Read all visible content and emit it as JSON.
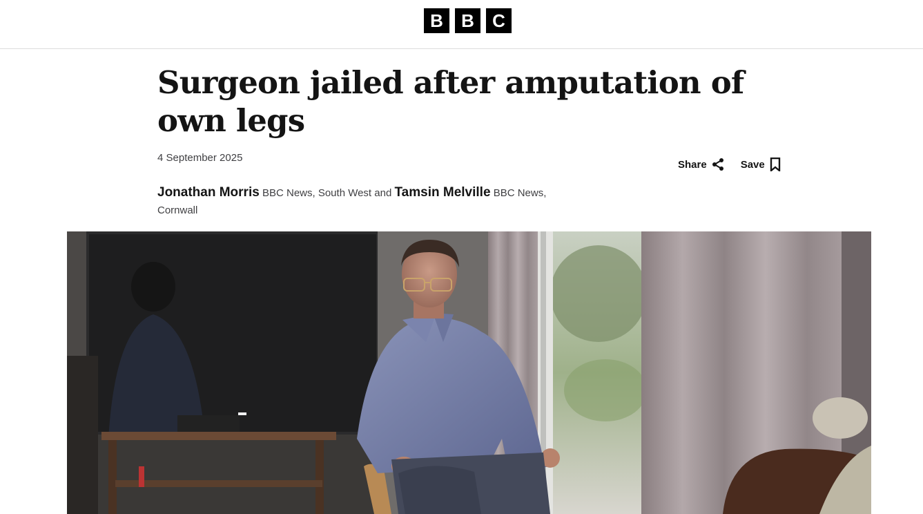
{
  "brand": {
    "logo_letters": [
      "B",
      "B",
      "C"
    ]
  },
  "article": {
    "headline": "Surgeon jailed after amputation of own legs",
    "date": "4 September 2025",
    "share_label": "Share",
    "save_label": "Save",
    "byline": {
      "author1": "Jonathan Morris",
      "author1_role": "BBC News, South West",
      "conjunction": "and",
      "author2": "Tamsin Melville",
      "author2_role": "BBC News, Cornwall"
    }
  },
  "colors": {
    "text": "#141414",
    "meta": "#3f3f42",
    "divider": "#dcdcdc"
  },
  "icons": {
    "share": "share-icon",
    "save": "bookmark-icon"
  }
}
